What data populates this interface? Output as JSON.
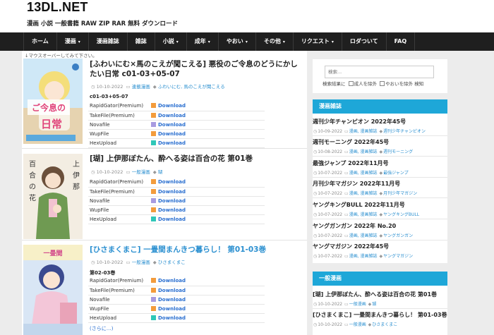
{
  "site": {
    "title": "13DL.NET",
    "tagline": "漫画 小説 一般書籍 RAW ZIP RAR 無料 ダウンロード"
  },
  "nav": [
    {
      "label": "ホーム",
      "caret": ""
    },
    {
      "label": "漫画",
      "caret": "▾"
    },
    {
      "label": "漫画雑誌",
      "caret": ""
    },
    {
      "label": "雑誌",
      "caret": ""
    },
    {
      "label": "小説",
      "caret": "▾"
    },
    {
      "label": "成年",
      "caret": "▾"
    },
    {
      "label": "やおい",
      "caret": "▾"
    },
    {
      "label": "その他",
      "caret": "▾"
    },
    {
      "label": "リクエスト",
      "caret": "▾"
    },
    {
      "label": "ロダついて",
      "caret": ""
    },
    {
      "label": "FAQ",
      "caret": ""
    }
  ],
  "hint": "↓マウスオーバーしてみて下さい。",
  "posts": [
    {
      "title": "[ふわいにむ×馬のこえが聞こえる] 悪役のご令息のどうにかしたい日常 c01-03+05-07",
      "date": "10-10-2022",
      "category": "連載漫画",
      "tag": "ふわいにむ, 馬のこえが聞こえる",
      "chapter": "c01-03+05-07",
      "hosts": [
        {
          "name": "RapidGator(Premium)",
          "color": "#f39c3c",
          "link": "Download"
        },
        {
          "name": "TakeFile(Premium)",
          "color": "#f39c3c",
          "link": "Download"
        },
        {
          "name": "Novafile",
          "color": "#a89be0",
          "link": "Download"
        },
        {
          "name": "WupFile",
          "color": "#f39c3c",
          "link": "Download"
        },
        {
          "name": "HexUpload",
          "color": "#2fc7b8",
          "link": "Download"
        }
      ]
    },
    {
      "title": "[瑚] 上伊那ぼたん、酔へる姿は百合の花 第01巻",
      "date": "10-10-2022",
      "category": "一般漫画",
      "tag": "瑚",
      "chapter": "",
      "hosts": [
        {
          "name": "RapidGator(Premium)",
          "color": "#f39c3c",
          "link": "Download"
        },
        {
          "name": "TakeFile(Premium)",
          "color": "#f39c3c",
          "link": "Download"
        },
        {
          "name": "Novafile",
          "color": "#a89be0",
          "link": "Download"
        },
        {
          "name": "WupFile",
          "color": "#f39c3c",
          "link": "Download"
        },
        {
          "name": "HexUpload",
          "color": "#2fc7b8",
          "link": "Download"
        }
      ]
    },
    {
      "title": "[ひさまくまこ] 一畳間まんきつ暮らし！ 第01-03巻",
      "date": "10-10-2022",
      "category": "一般漫画",
      "tag": "ひさまくまこ",
      "chapter": "第02-03巻",
      "hosts": [
        {
          "name": "RapidGator(Premium)",
          "color": "#f39c3c",
          "link": "Download"
        },
        {
          "name": "TakeFile(Premium)",
          "color": "#f39c3c",
          "link": "Download"
        },
        {
          "name": "Novafile",
          "color": "#a89be0",
          "link": "Download"
        },
        {
          "name": "WupFile",
          "color": "#f39c3c",
          "link": "Download"
        },
        {
          "name": "HexUpload",
          "color": "#2fc7b8",
          "link": "Download"
        }
      ],
      "more": "(さらに…)"
    }
  ],
  "search": {
    "placeholder": "検索...",
    "options_label": "検索結果に",
    "opt1": "成人を除外",
    "opt2": "やおいを除外",
    "opt_suffix": "検知"
  },
  "widget_magazine": {
    "heading": "漫画雑誌",
    "items": [
      {
        "title": "週刊少年チャンピオン 2022年45号",
        "date": "10-09-2022",
        "cats": "漫画, 漫画雑誌",
        "tag": "週刊少年チャンピオン"
      },
      {
        "title": "週刊モーニング 2022年45号",
        "date": "10-08-2022",
        "cats": "漫画, 漫画雑誌",
        "tag": "週刊モーニング"
      },
      {
        "title": "最強ジャンプ 2022年11月号",
        "date": "10-07-2022",
        "cats": "漫画, 漫画雑誌",
        "tag": "最強ジャンプ"
      },
      {
        "title": "月刊少年マガジン 2022年11月号",
        "date": "10-07-2022",
        "cats": "漫画, 漫画雑誌",
        "tag": "月刊少年マガジン"
      },
      {
        "title": "ヤングキングBULL 2022年11月号",
        "date": "10-07-2022",
        "cats": "漫画, 漫画雑誌",
        "tag": "ヤングキングBULL"
      },
      {
        "title": "ヤングガンガン 2022年 No.20",
        "date": "10-07-2022",
        "cats": "漫画, 漫画雑誌",
        "tag": "ヤングガンガン"
      },
      {
        "title": "ヤングマガジン 2022年45号",
        "date": "10-07-2022",
        "cats": "漫画, 漫画雑誌",
        "tag": "ヤングマガジン"
      }
    ]
  },
  "widget_general": {
    "heading": "一般漫画",
    "items": [
      {
        "title": "[瑚] 上伊那ぼたん、酔へる姿は百合の花 第01巻",
        "date": "10-10-2022",
        "cats": "一般漫画",
        "tag": "瑚"
      },
      {
        "title": "[ひさまくまこ] 一畳間まんきつ暮らし！ 第01-03巻",
        "date": "10-10-2022",
        "cats": "一般漫画",
        "tag": "ひさまくまこ"
      }
    ]
  },
  "colors": {
    "accent": "#1ea7d8",
    "nav_bg": "#1f1f1f",
    "link": "#2a8fd0"
  }
}
